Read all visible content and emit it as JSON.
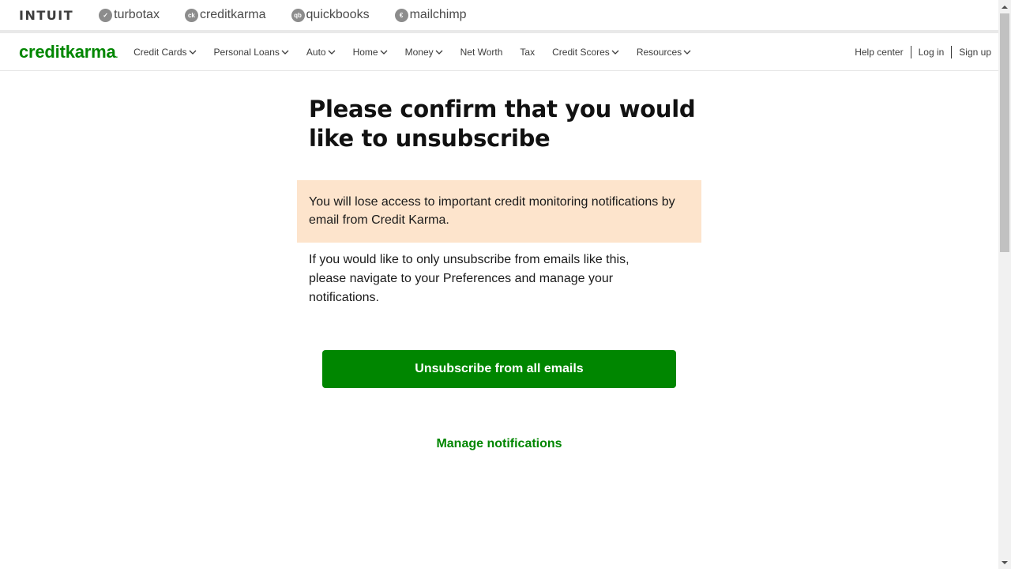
{
  "brandbar": {
    "intuit": "INTUIT",
    "items": [
      {
        "label": "turbotax",
        "icon": "turbotax-check-icon",
        "glyph": "✓"
      },
      {
        "label": "creditkarma",
        "icon": "creditkarma-ck-icon",
        "glyph": "ck"
      },
      {
        "label": "quickbooks",
        "icon": "quickbooks-qb-icon",
        "glyph": "qb"
      },
      {
        "label": "mailchimp",
        "icon": "mailchimp-icon",
        "glyph": "€"
      }
    ]
  },
  "nav": {
    "logo": "creditkarma",
    "logo_dot": ".",
    "items": [
      {
        "label": "Credit Cards",
        "dropdown": true
      },
      {
        "label": "Personal Loans",
        "dropdown": true
      },
      {
        "label": "Auto",
        "dropdown": true
      },
      {
        "label": "Home",
        "dropdown": true
      },
      {
        "label": "Money",
        "dropdown": true
      },
      {
        "label": "Net Worth",
        "dropdown": false
      },
      {
        "label": "Tax",
        "dropdown": false
      },
      {
        "label": "Credit Scores",
        "dropdown": true
      },
      {
        "label": "Resources",
        "dropdown": true
      }
    ],
    "help": "Help center",
    "login": "Log in",
    "signup": "Sign up"
  },
  "main": {
    "title": "Please confirm that you would like to unsubscribe",
    "warning": "You will lose access to important credit monitoring notifications by email from Credit Karma.",
    "info": "If you would like to only unsubscribe from emails like this, please navigate to your Preferences and manage your notifications.",
    "unsubscribe_button": "Unsubscribe from all emails",
    "manage_link": "Manage notifications"
  },
  "colors": {
    "brand_green": "#008600",
    "warning_bg": "#fde4cc"
  }
}
